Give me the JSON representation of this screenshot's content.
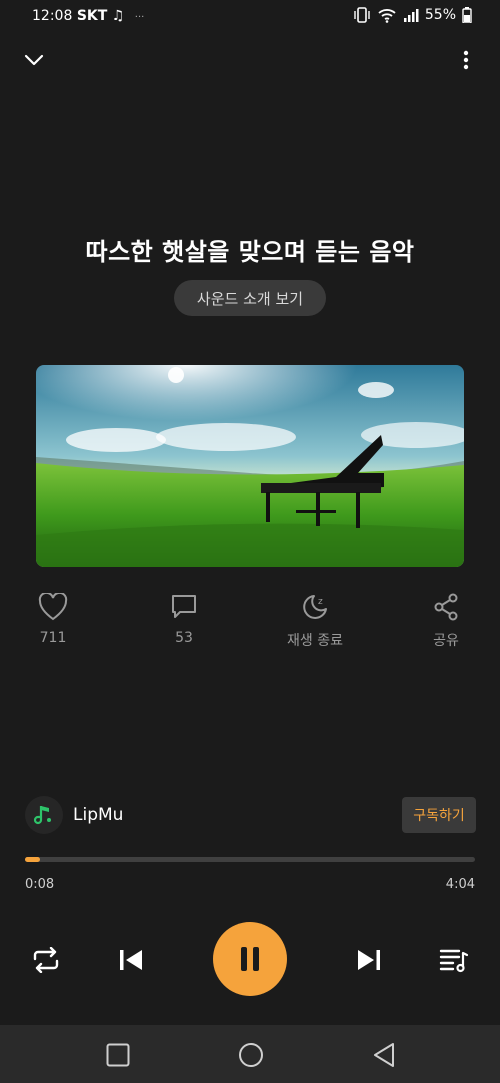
{
  "status": {
    "time": "12:08",
    "carrier": "SKT",
    "battery": "55%"
  },
  "header": {
    "collapse_icon": "chevron-down-icon",
    "menu_icon": "more-vertical-icon"
  },
  "track": {
    "title": "따스한 햇살을 맞으며 듣는 음악",
    "sound_button": "사운드 소개 보기",
    "artwork": "grand-piano-in-green-field"
  },
  "actions": [
    {
      "icon": "heart-icon",
      "label": "711"
    },
    {
      "icon": "comment-icon",
      "label": "53"
    },
    {
      "icon": "sleep-timer-icon",
      "label": "재생 종료"
    },
    {
      "icon": "share-icon",
      "label": "공유"
    }
  ],
  "channel": {
    "name": "LipMu",
    "subscribe": "구독하기"
  },
  "player": {
    "current_time": "0:08",
    "total_time": "4:04",
    "progress": 0.033,
    "state": "playing"
  },
  "colors": {
    "accent": "#f5a33c",
    "background": "#1b1b1b"
  }
}
